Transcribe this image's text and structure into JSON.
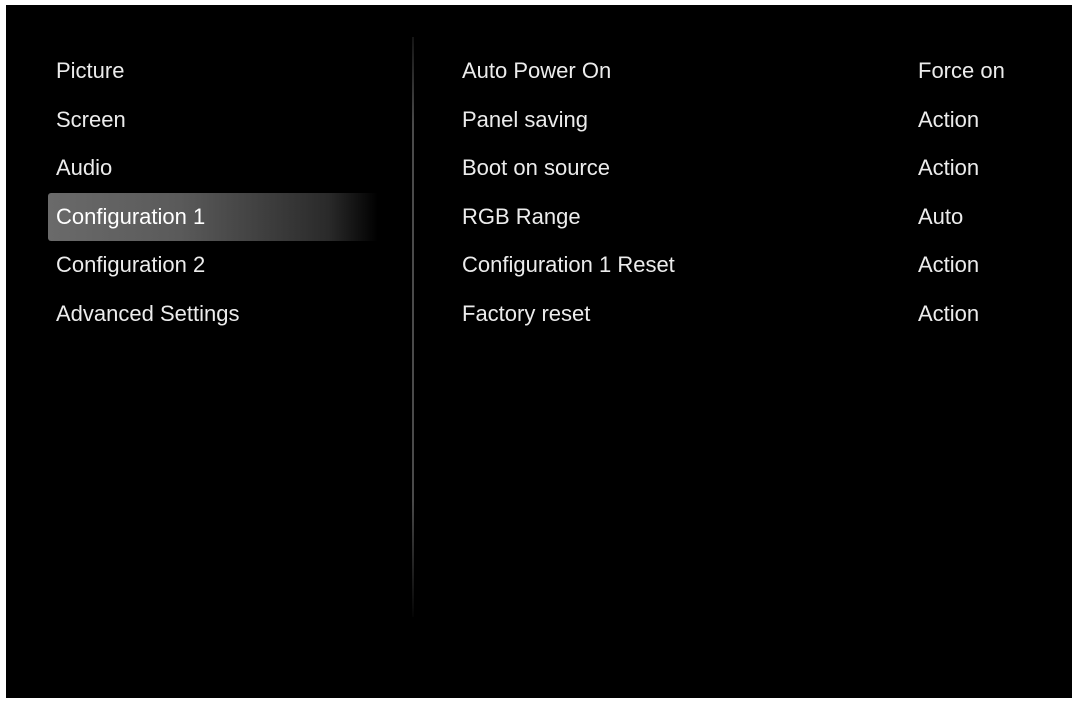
{
  "menu": {
    "selected_index": 3,
    "categories": [
      {
        "label": "Picture"
      },
      {
        "label": "Screen"
      },
      {
        "label": "Audio"
      },
      {
        "label": "Configuration 1"
      },
      {
        "label": "Configuration 2"
      },
      {
        "label": "Advanced Settings"
      }
    ]
  },
  "settings": [
    {
      "label": "Auto Power On",
      "value": "Force on"
    },
    {
      "label": "Panel saving",
      "value": "Action"
    },
    {
      "label": "Boot on source",
      "value": "Action"
    },
    {
      "label": "RGB Range",
      "value": "Auto"
    },
    {
      "label": "Configuration 1 Reset",
      "value": "Action"
    },
    {
      "label": "Factory reset",
      "value": "Action"
    }
  ],
  "colors": {
    "background": "#000000",
    "text": "#ececec",
    "selection_highlight": "#6a6a6a"
  }
}
